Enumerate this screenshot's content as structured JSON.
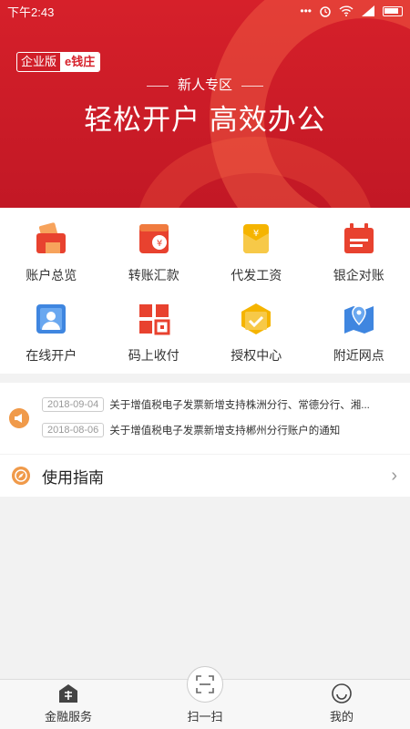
{
  "status_bar": {
    "time": "下午2:43",
    "icons": [
      "dots-icon",
      "alarm-icon",
      "wifi-icon",
      "signal-icon",
      "battery-icon"
    ]
  },
  "hero": {
    "logo_left": "企业版",
    "logo_right": "e钱庄",
    "subtitle": "新人专区",
    "title": "轻松开户 高效办公"
  },
  "grid": [
    {
      "label": "账户总览",
      "icon": "account-overview-icon"
    },
    {
      "label": "转账汇款",
      "icon": "transfer-icon"
    },
    {
      "label": "代发工资",
      "icon": "payroll-icon"
    },
    {
      "label": "银企对账",
      "icon": "reconciliation-icon"
    },
    {
      "label": "在线开户",
      "icon": "online-account-icon"
    },
    {
      "label": "码上收付",
      "icon": "qr-pay-icon"
    },
    {
      "label": "授权中心",
      "icon": "authorization-icon"
    },
    {
      "label": "附近网点",
      "icon": "nearby-branch-icon"
    }
  ],
  "notices": [
    {
      "date": "2018-09-04",
      "text": "关于增值税电子发票新增支持株洲分行、常德分行、湘..."
    },
    {
      "date": "2018-08-06",
      "text": "关于增值税电子发票新增支持郴州分行账户的通知"
    }
  ],
  "guide": {
    "label": "使用指南"
  },
  "tabs": [
    {
      "label": "金融服务"
    },
    {
      "label": "扫一扫"
    },
    {
      "label": "我的"
    }
  ],
  "colors": {
    "brand_red": "#d6202a",
    "accent_orange": "#f09a4a"
  }
}
